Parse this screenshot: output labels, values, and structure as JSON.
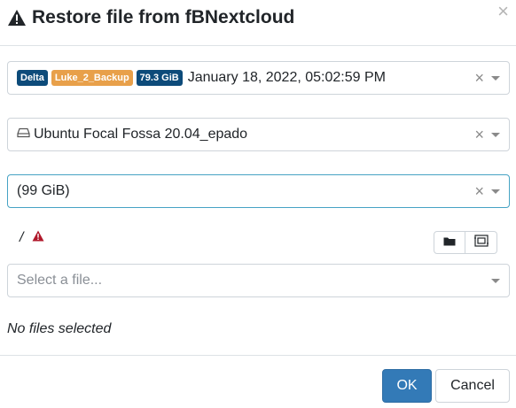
{
  "dialog": {
    "title": "Restore file from fBNextcloud",
    "close_icon": "×"
  },
  "backup_select": {
    "badges": {
      "type": "Delta",
      "backup": "Luke_2_Backup",
      "size": "79.3 GiB"
    },
    "date": "January 18, 2022, 05:02:59 PM",
    "clear": "×"
  },
  "disk_select": {
    "value": "Ubuntu Focal Fossa 20.04_epado",
    "clear": "×"
  },
  "partition_select": {
    "value": "(99 GiB)",
    "clear": "×"
  },
  "path": {
    "root": "/"
  },
  "file_select": {
    "placeholder": "Select a file..."
  },
  "status": {
    "no_files": "No files selected"
  },
  "footer": {
    "ok_label": "OK",
    "cancel_label": "Cancel"
  },
  "colors": {
    "badge_delta": "#0d4b7a",
    "badge_backup": "#e8a04a",
    "badge_size": "#0d4b7a",
    "ok_button": "#337ab7",
    "warning_red": "#b0182b",
    "focus_border": "#46a3c4"
  },
  "icons": {
    "title": "warning-triangle-icon",
    "disk": "hard-drive-icon",
    "path_warning": "warning-triangle-icon",
    "folder": "folder-icon",
    "select_all": "select-all-icon"
  }
}
